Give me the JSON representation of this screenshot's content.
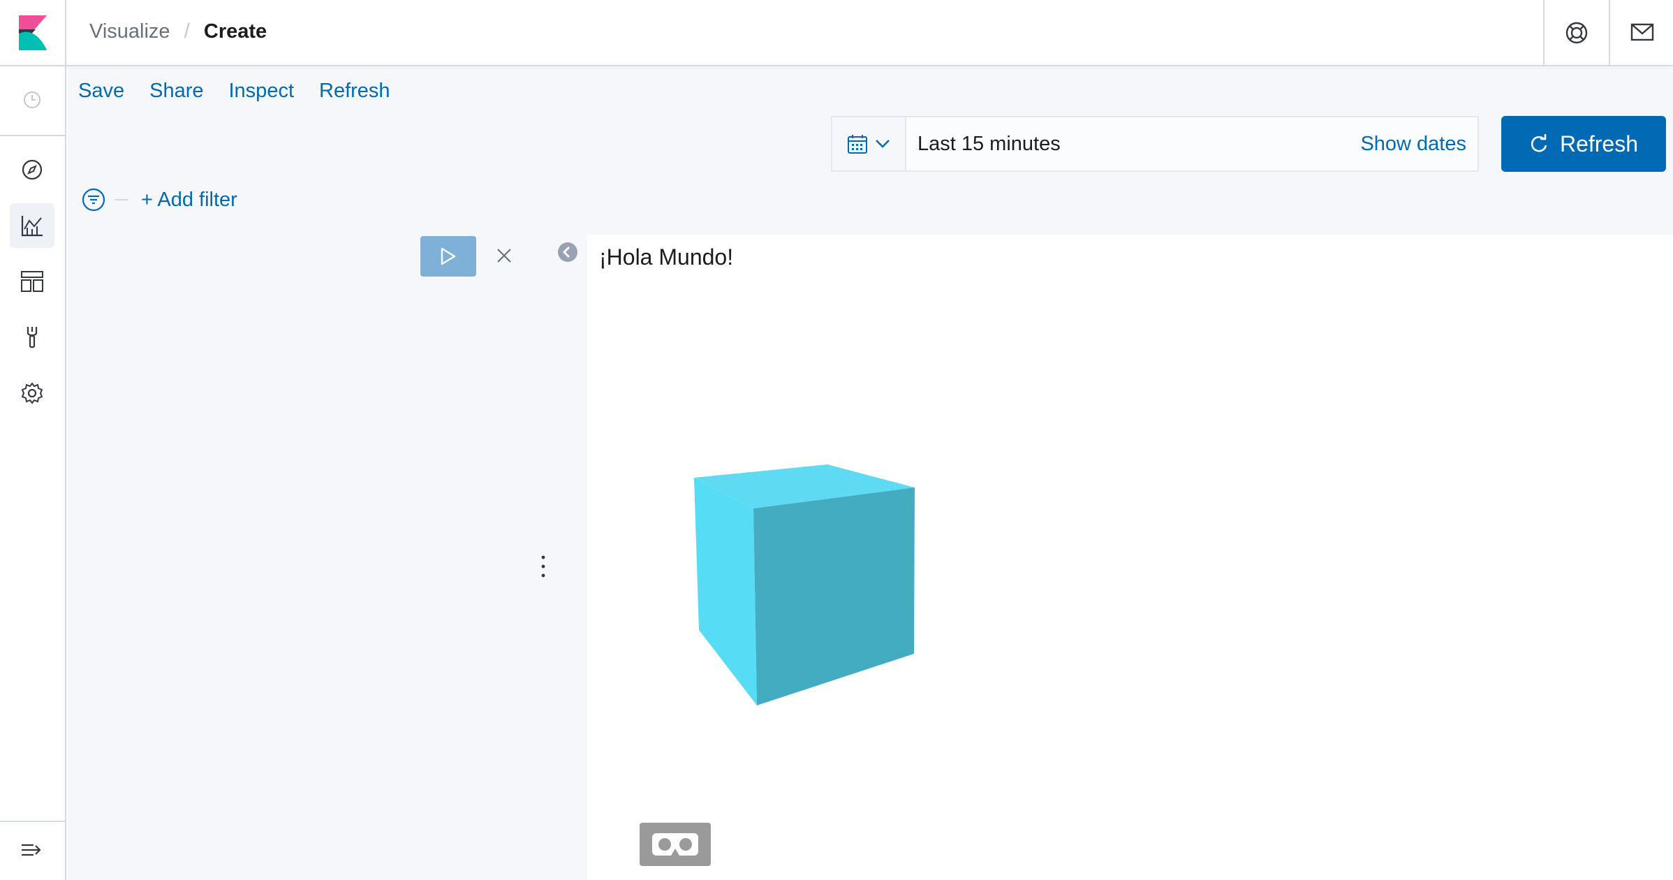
{
  "header": {
    "breadcrumbs": [
      "Visualize",
      "Create"
    ],
    "separator": "/"
  },
  "sidenav": {
    "items": [
      "recently-viewed",
      "discover",
      "visualize",
      "dashboard",
      "dev-tools",
      "management"
    ],
    "active": "visualize"
  },
  "topnav": {
    "items": [
      "Save",
      "Share",
      "Inspect",
      "Refresh"
    ]
  },
  "datepicker": {
    "range": "Last 15 minutes",
    "show_dates": "Show dates"
  },
  "refresh_button": {
    "label": "Refresh",
    "color": "#006bb4"
  },
  "filter": {
    "add_label": "+ Add filter"
  },
  "viz": {
    "text": "¡Hola Mundo!",
    "cube_colors": {
      "top": "#5edbf2",
      "left": "#56ddf5",
      "right": "#43acc0"
    }
  },
  "colors": {
    "accent": "#006bb4",
    "background": "#f5f7fa"
  }
}
